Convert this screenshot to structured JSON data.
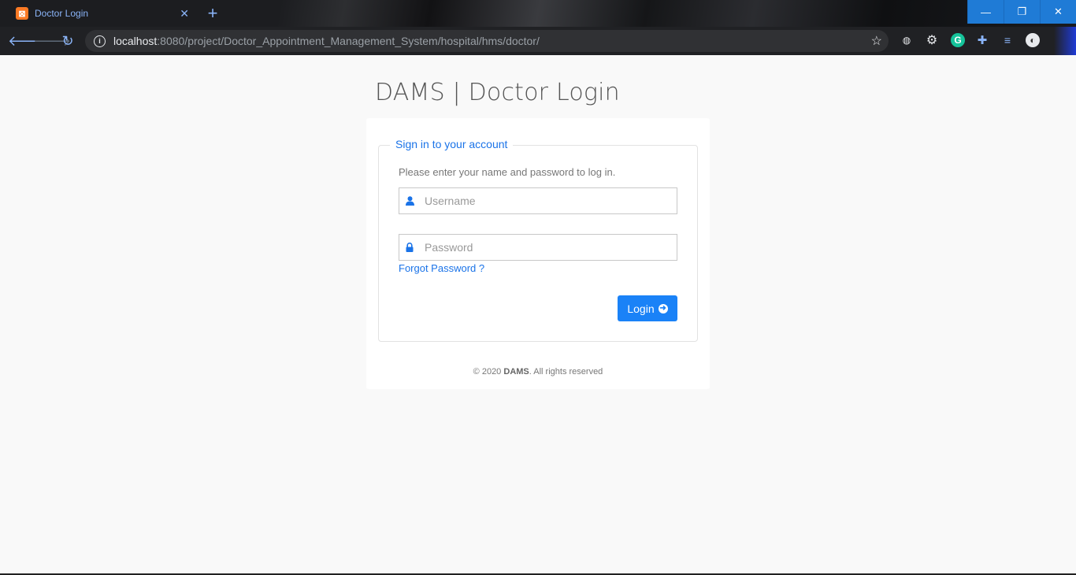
{
  "browser": {
    "tab_title": "Doctor Login",
    "tab_favicon": "xampp-icon",
    "url_host": "localhost",
    "url_rest": ":8080/project/Doctor_Appointment_Management_System/hospital/hms/doctor/",
    "window_buttons": [
      "minimize",
      "restore",
      "close"
    ],
    "extensions": [
      "globe-icon",
      "gear-icon",
      "grammarly-icon",
      "puzzle-icon",
      "playlist-icon",
      "avatar-icon"
    ]
  },
  "page": {
    "title": "DAMS | Doctor Login",
    "legend": "Sign in to your account",
    "hint": "Please enter your name and password to log in.",
    "username_placeholder": "Username",
    "password_placeholder": "Password",
    "forgot_label": "Forgot Password ?",
    "login_label": "Login",
    "footer_prefix": "© 2020 ",
    "footer_brand": "DAMS",
    "footer_suffix": ". All rights reserved"
  },
  "colors": {
    "accent": "#1a73e8",
    "button": "#1a82f7",
    "chrome_bg": "#202124",
    "page_bg": "#f9f9f9"
  }
}
